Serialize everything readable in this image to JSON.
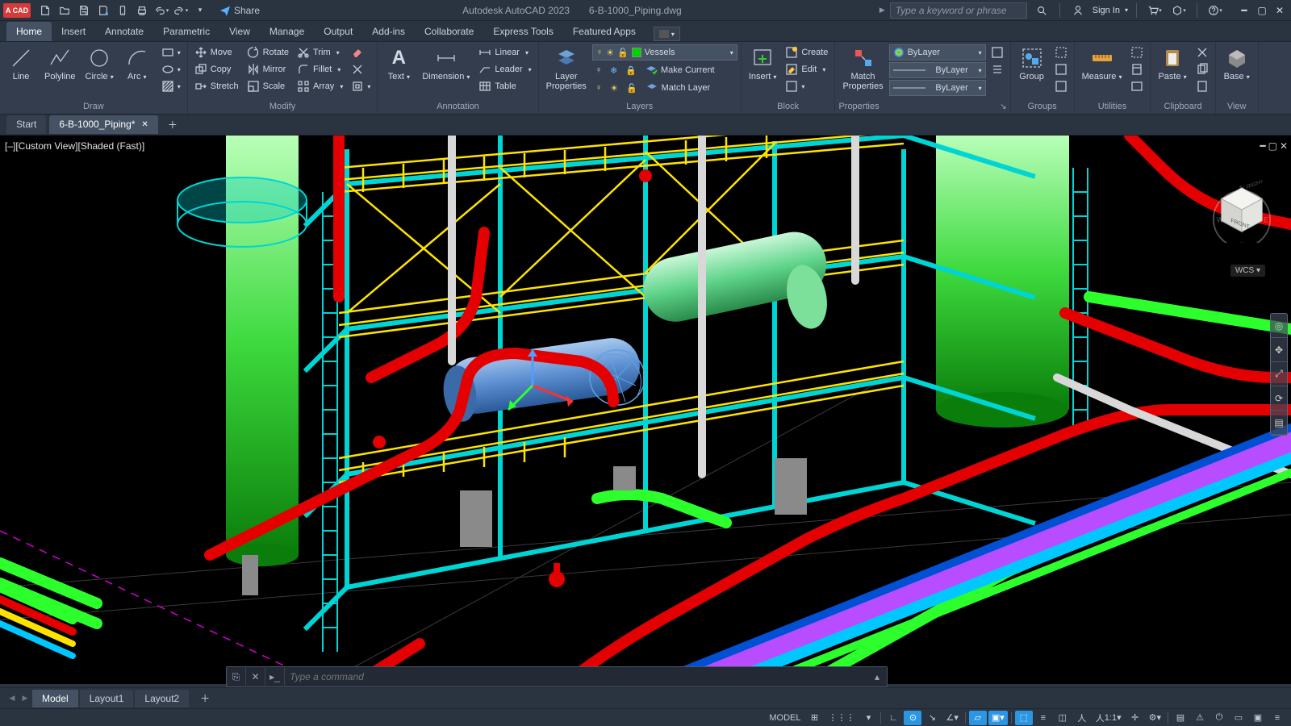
{
  "qat": {
    "logo": "A CAD",
    "share": "Share"
  },
  "title": {
    "app": "Autodesk AutoCAD 2023",
    "file": "6-B-1000_Piping.dwg"
  },
  "search": {
    "placeholder": "Type a keyword or phrase"
  },
  "account": {
    "signin": "Sign In"
  },
  "tabs": [
    "Home",
    "Insert",
    "Annotate",
    "Parametric",
    "View",
    "Manage",
    "Output",
    "Add-ins",
    "Collaborate",
    "Express Tools",
    "Featured Apps"
  ],
  "active_tab": "Home",
  "ribbon": {
    "draw": {
      "title": "Draw",
      "line": "Line",
      "polyline": "Polyline",
      "circle": "Circle",
      "arc": "Arc"
    },
    "modify": {
      "title": "Modify",
      "move": "Move",
      "rotate": "Rotate",
      "trim": "Trim",
      "copy": "Copy",
      "mirror": "Mirror",
      "fillet": "Fillet",
      "stretch": "Stretch",
      "scale": "Scale",
      "array": "Array"
    },
    "annotation": {
      "title": "Annotation",
      "text": "Text",
      "dimension": "Dimension",
      "linear": "Linear",
      "leader": "Leader",
      "table": "Table"
    },
    "layers": {
      "title": "Layers",
      "props": "Layer\nProperties",
      "current_layer": "Vessels",
      "make_current": "Make Current",
      "match": "Match Layer"
    },
    "block": {
      "title": "Block",
      "insert": "Insert",
      "create": "Create",
      "edit": "Edit"
    },
    "properties": {
      "title": "Properties",
      "match": "Match\nProperties",
      "bylayer": "ByLayer"
    },
    "groups": {
      "title": "Groups",
      "group": "Group"
    },
    "utilities": {
      "title": "Utilities",
      "measure": "Measure"
    },
    "clipboard": {
      "title": "Clipboard",
      "paste": "Paste"
    },
    "view": {
      "title": "View",
      "base": "Base"
    }
  },
  "filetabs": {
    "start": "Start",
    "doc": "6-B-1000_Piping*"
  },
  "viewport": {
    "label": "[–][Custom View][Shaded (Fast)]",
    "wcs": "WCS",
    "cube": {
      "front": "FRONT",
      "right": "RIGHT"
    }
  },
  "layouts": [
    "Model",
    "Layout1",
    "Layout2"
  ],
  "active_layout": "Model",
  "cmd": {
    "placeholder": "Type a command"
  },
  "status": {
    "model": "MODEL",
    "scale": "1:1"
  },
  "colors": {
    "green": "#00d400",
    "red": "#e40000",
    "cyan": "#00d5d5",
    "yellow": "#ffe300",
    "magenta": "#d400d4",
    "blue": "#3a6aff",
    "steel": "#7fa4c9",
    "grey": "#9a9a9a",
    "lime": "#2cff2c"
  }
}
